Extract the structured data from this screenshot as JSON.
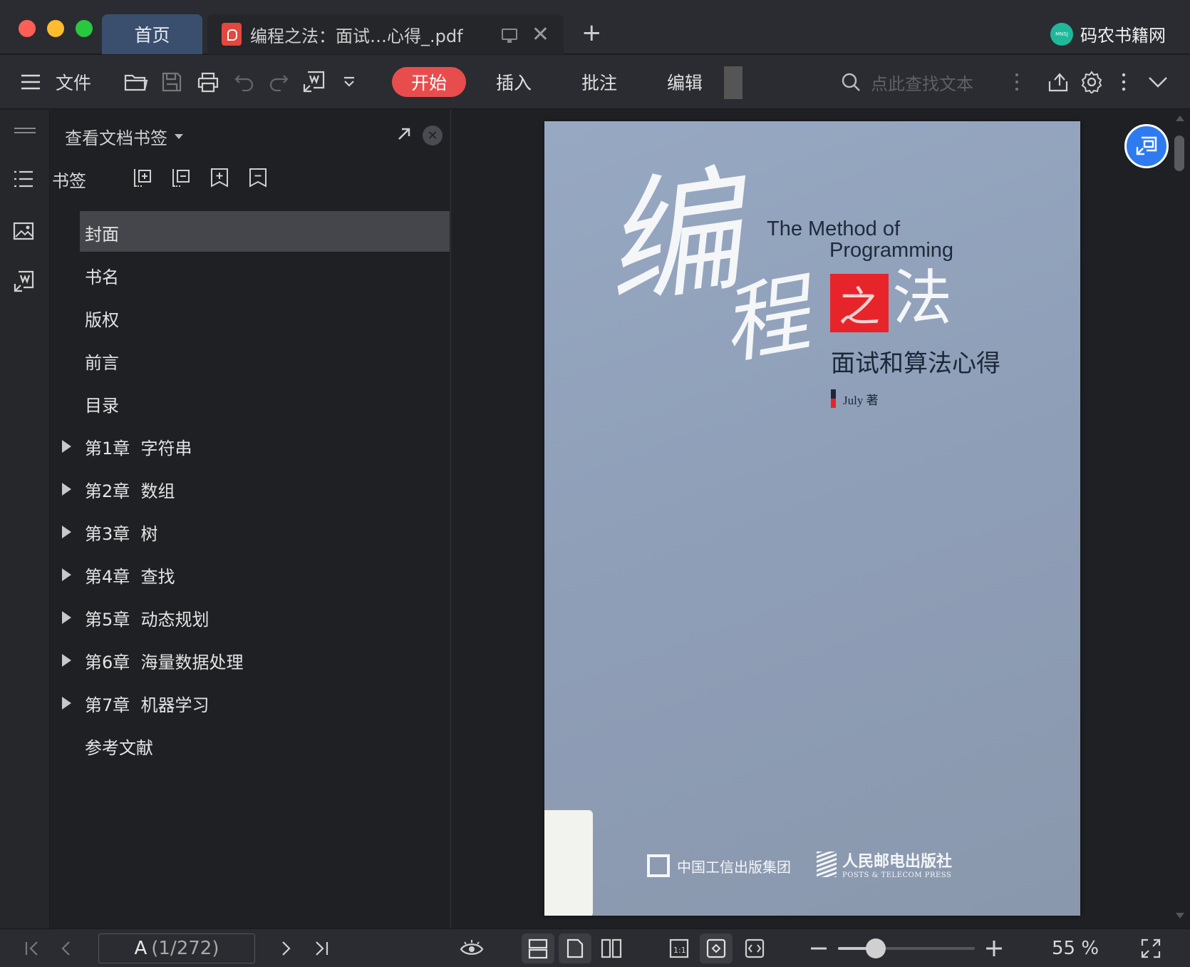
{
  "titlebar": {
    "home_tab": "首页",
    "doc_tab": "编程之法：面试…心得_.pdf",
    "close_glyph": "✕",
    "add_glyph": "+",
    "brand_logo_text": "MNSJ",
    "brand": "码农书籍网"
  },
  "toolbar": {
    "file_label": "文件",
    "start_label": "开始",
    "insert_label": "插入",
    "annotate_label": "批注",
    "edit_label": "编辑",
    "search_placeholder": "点此查找文本"
  },
  "panel": {
    "header": "查看文档书签",
    "close_glyph": "✕",
    "bookmark_label": "书签",
    "items": [
      {
        "label": "封面",
        "expandable": false,
        "selected": true
      },
      {
        "label": "书名",
        "expandable": false,
        "selected": false
      },
      {
        "label": "版权",
        "expandable": false,
        "selected": false
      },
      {
        "label": "前言",
        "expandable": false,
        "selected": false
      },
      {
        "label": "目录",
        "expandable": false,
        "selected": false
      },
      {
        "label": "第1章  字符串",
        "expandable": true,
        "selected": false
      },
      {
        "label": "第2章  数组",
        "expandable": true,
        "selected": false
      },
      {
        "label": "第3章  树",
        "expandable": true,
        "selected": false
      },
      {
        "label": "第4章  查找",
        "expandable": true,
        "selected": false
      },
      {
        "label": "第5章  动态规划",
        "expandable": true,
        "selected": false
      },
      {
        "label": "第6章  海量数据处理",
        "expandable": true,
        "selected": false
      },
      {
        "label": "第7章  机器学习",
        "expandable": true,
        "selected": false
      },
      {
        "label": "参考文献",
        "expandable": false,
        "selected": false
      }
    ]
  },
  "cover": {
    "title_en_1": "The Method of",
    "title_en_2": "Programming",
    "title_bian": "编",
    "title_cheng": "程",
    "title_zhi": "之",
    "title_fa": "法",
    "subtitle": "面试和算法心得",
    "author": "July  著",
    "publisher1": "中国工信出版集团",
    "publisher2": "人民邮电出版社",
    "publisher2_en": "POSTS & TELECOM PRESS"
  },
  "statusbar": {
    "page_label": "A",
    "page_count": "(1/272)",
    "zoom_percent": 55,
    "zoom_text": "55 %"
  },
  "colors": {
    "accent_red": "#e84d4d",
    "float_button": "#2e7bf0",
    "brand_green": "#1fb89a"
  }
}
